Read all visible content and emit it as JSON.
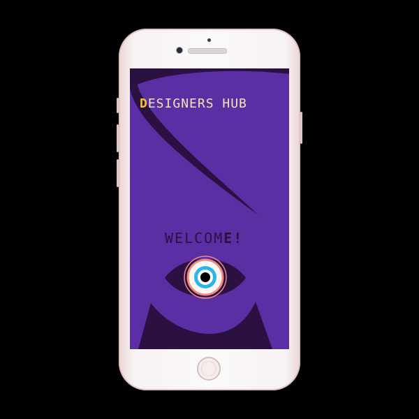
{
  "app": {
    "title_first_letter": "D",
    "title_rest": "ESIGNERS HUB",
    "welcome_main": "WELCOM",
    "welcome_accent": "E!"
  },
  "colors": {
    "screen_background": "#5a2fa3",
    "dark_shape": "#2a1142",
    "title_text": "#f2e3b8",
    "title_accent": "#f4c430",
    "eye_iris": "#29b6e8",
    "eye_ring": "#f08a7e",
    "phone_body": "#fbf9fa"
  },
  "icons": {
    "eye": "eye-icon",
    "home": "home-button-icon"
  }
}
